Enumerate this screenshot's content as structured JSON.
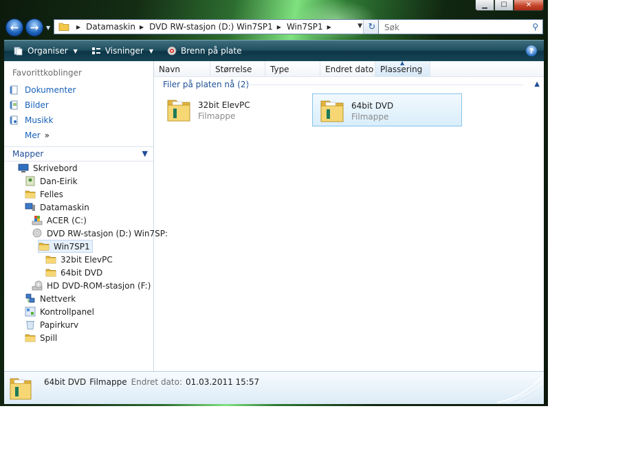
{
  "window": {
    "controls": {
      "minimize": "▁",
      "maximize": "☐",
      "close": "✕"
    }
  },
  "nav": {
    "back_glyph": "←",
    "forward_glyph": "→",
    "breadcrumb": [
      "Datamaskin",
      "DVD RW-stasjon (D:) Win7SP1",
      "Win7SP1"
    ],
    "search_placeholder": "Søk"
  },
  "toolbar": {
    "organise": "Organiser",
    "views": "Visninger",
    "burn": "Brenn på plate",
    "help": "?"
  },
  "sidebar": {
    "favorites_title": "Favorittkoblinger",
    "favorites": [
      {
        "label": "Dokumenter",
        "icon": "documents-icon"
      },
      {
        "label": "Bilder",
        "icon": "pictures-icon"
      },
      {
        "label": "Musikk",
        "icon": "music-icon"
      },
      {
        "label": "Mer",
        "icon": "more-chevron-icon"
      }
    ],
    "more_glyph": "»",
    "folders_title": "Mapper",
    "tree": [
      {
        "label": "Skrivebord",
        "icon": "desktop-icon"
      },
      {
        "label": "Dan-Eirik",
        "icon": "user-folder-icon"
      },
      {
        "label": "Felles",
        "icon": "folder-icon"
      },
      {
        "label": "Datamaskin",
        "icon": "computer-icon"
      },
      {
        "label": "ACER (C:)",
        "icon": "windows-drive-icon"
      },
      {
        "label": "DVD RW-stasjon (D:) Win7SP:",
        "icon": "dvd-drive-icon"
      },
      {
        "label": "Win7SP1",
        "icon": "folder-icon"
      },
      {
        "label": "32bit ElevPC",
        "icon": "folder-icon"
      },
      {
        "label": "64bit DVD",
        "icon": "folder-icon"
      },
      {
        "label": "HD DVD-ROM-stasjon (F:)",
        "icon": "hd-dvd-drive-icon"
      },
      {
        "label": "Nettverk",
        "icon": "network-icon"
      },
      {
        "label": "Kontrollpanel",
        "icon": "control-panel-icon"
      },
      {
        "label": "Papirkurv",
        "icon": "recycle-bin-icon"
      },
      {
        "label": "Spill",
        "icon": "folder-icon"
      }
    ]
  },
  "columns": [
    "Navn",
    "Størrelse",
    "Type",
    "Endret dato",
    "Plassering"
  ],
  "group": {
    "title": "Filer på platen nå (2)",
    "items": [
      {
        "name": "32bit ElevPC",
        "type": "Filmappe"
      },
      {
        "name": "64bit DVD",
        "type": "Filmappe"
      }
    ]
  },
  "status": {
    "name": "64bit DVD",
    "type": "Filmappe",
    "modified_label": "Endret dato:",
    "modified_value": "01.03.2011 15:57"
  },
  "colors": {
    "toolbar": "#1e4d5e",
    "link": "#1660bb",
    "selection": "#d9eefb",
    "folder": "#f2c84b"
  }
}
